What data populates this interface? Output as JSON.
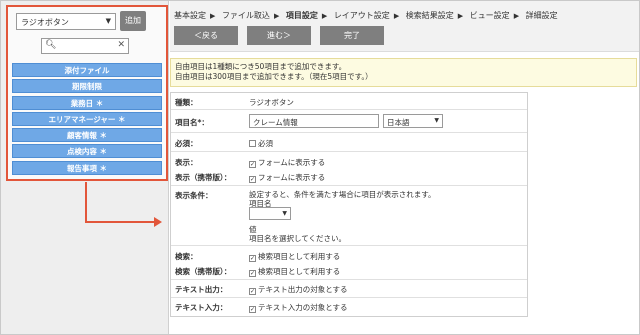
{
  "left": {
    "type_select": "ラジオボタン",
    "add_label": "追加",
    "search_value": "",
    "fields": [
      {
        "label": "添付ファイル"
      },
      {
        "label": "期限制限"
      },
      {
        "label": "業務日 ＊"
      },
      {
        "label": "エリアマネージャー ＊"
      },
      {
        "label": "顧客情報 ＊"
      },
      {
        "label": "点検内容 ＊"
      },
      {
        "label": "報告事項 ＊"
      }
    ]
  },
  "breadcrumb": [
    "基本設定",
    "ファイル取込",
    "項目設定",
    "レイアウト設定",
    "検索結果設定",
    "ビュー設定",
    "詳細設定"
  ],
  "buttons": {
    "back": "＜戻る",
    "next": "進む＞",
    "done": "完了"
  },
  "notice": {
    "line1": "自由項目は1種類につき50項目まで追加できます。",
    "line2": "自由項目は300項目まで追加できます。（現在5項目です。）"
  },
  "form": {
    "type_label": "種類：",
    "type_value": "ラジオボタン",
    "name_label": "項目名*：",
    "name_value": "クレーム情報",
    "lang_value": "日本語",
    "required_label": "必須：",
    "required_option": "必須",
    "display_label": "表示：",
    "display_option": "フォームに表示する",
    "mobile_display_label": "表示（携帯版）：",
    "mobile_display_option": "フォームに表示する",
    "cond_label": "表示条件：",
    "cond_desc": "設定すると、条件を満たす場合に項目が表示されます。",
    "cond_item_label": "項目名",
    "cond_value_label": "値",
    "cond_value_hint": "項目名を選択してください。",
    "search_label": "検索：",
    "search_option": "検索項目として利用する",
    "mobile_search_label": "検索（携帯版）：",
    "mobile_search_option": "検索項目として利用する",
    "text_out_label": "テキスト出力：",
    "text_out_option": "テキスト出力の対象とする",
    "text_in_label": "テキスト入力：",
    "text_in_option": "テキスト入力の対象とする"
  },
  "colors": {
    "highlight": "#e2563a",
    "field_item": "#6fa8e6",
    "button": "#7f7f7f",
    "notice_bg": "#fdfbe1"
  }
}
